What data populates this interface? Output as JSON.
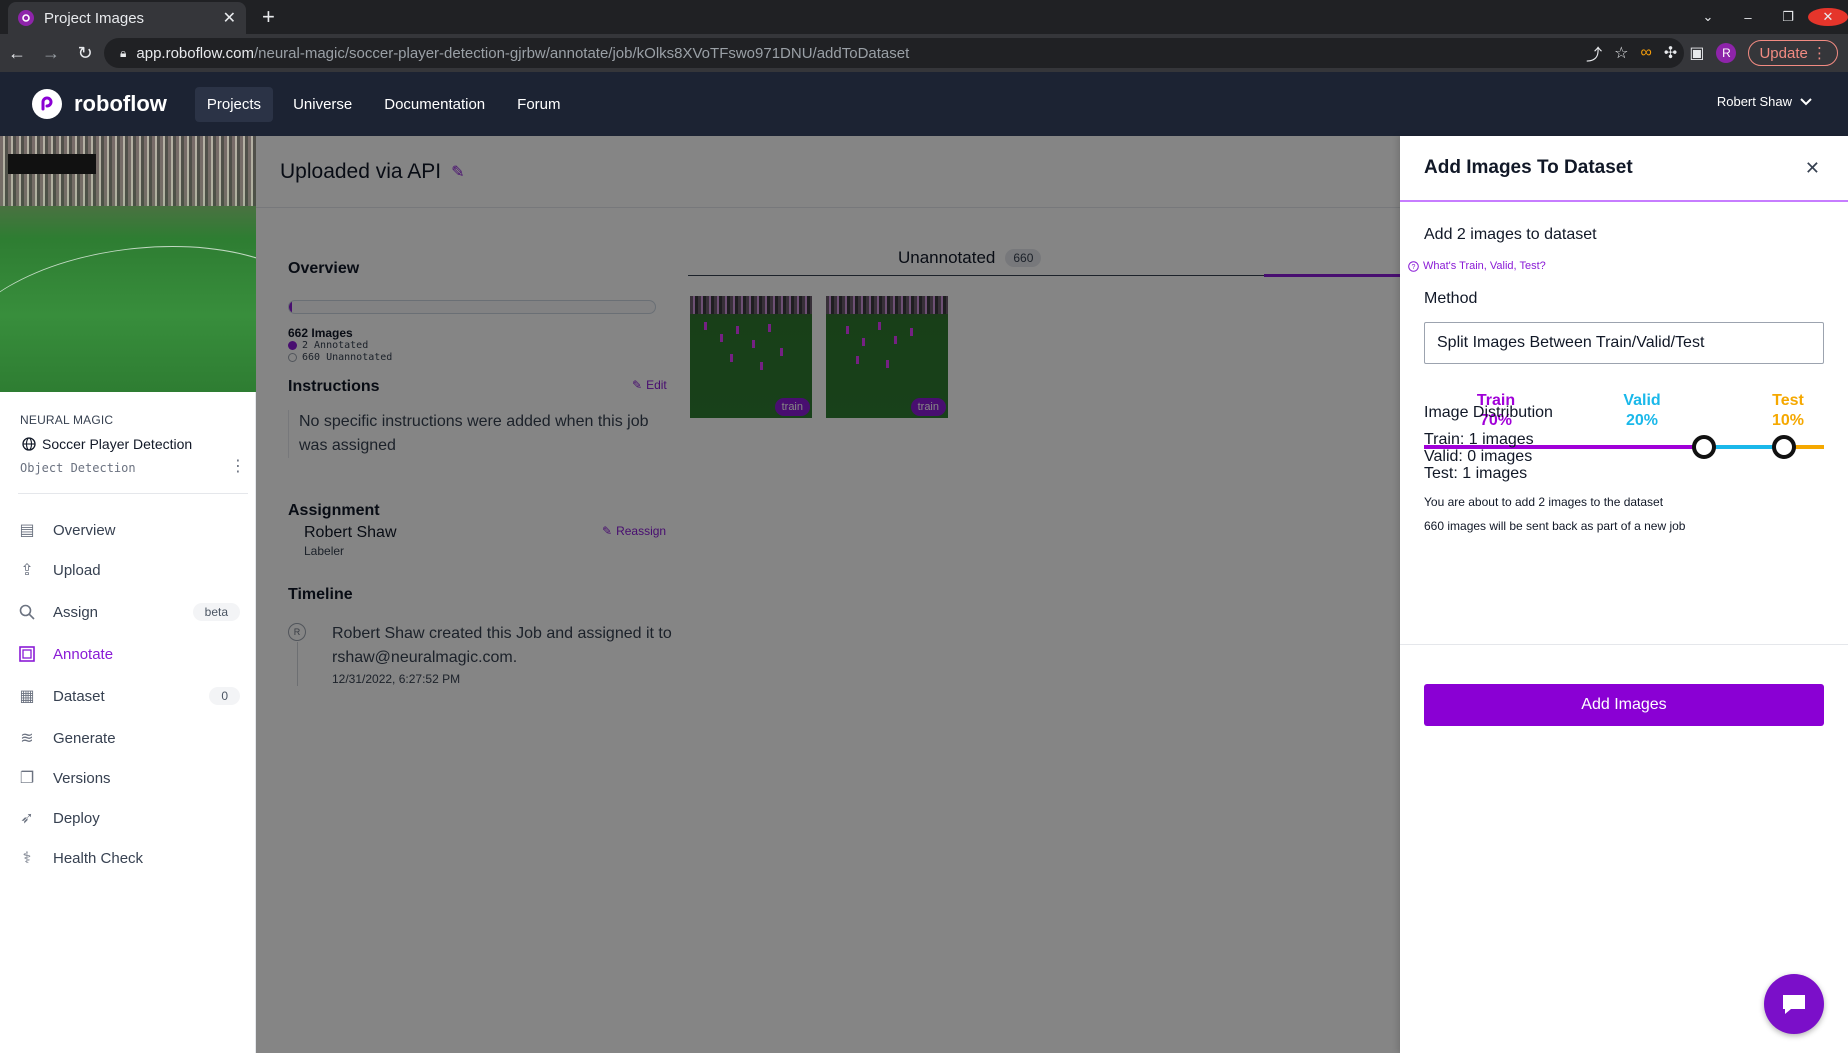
{
  "browser": {
    "tab_title": "Project Images",
    "url_host": "app.roboflow.com",
    "url_path": "/neural-magic/soccer-player-detection-gjrbw/annotate/job/kOlks8XVoTFswo971DNU/addToDataset",
    "profile_initial": "R",
    "update_label": "Update"
  },
  "appbar": {
    "brand": "roboflow",
    "nav": [
      "Projects",
      "Universe",
      "Documentation",
      "Forum"
    ],
    "active_nav": "Projects",
    "user_name": "Robert Shaw"
  },
  "sidebar": {
    "workspace": "NEURAL MAGIC",
    "project_name": "Soccer Player Detection",
    "project_type": "Object Detection",
    "items": [
      {
        "label": "Overview",
        "icon": "overview-icon"
      },
      {
        "label": "Upload",
        "icon": "upload-icon"
      },
      {
        "label": "Assign",
        "icon": "search-icon",
        "badge": "beta"
      },
      {
        "label": "Annotate",
        "icon": "annotate-icon",
        "active": true
      },
      {
        "label": "Dataset",
        "icon": "dataset-icon",
        "badge": "0"
      },
      {
        "label": "Generate",
        "icon": "generate-icon"
      },
      {
        "label": "Versions",
        "icon": "versions-icon"
      },
      {
        "label": "Deploy",
        "icon": "rocket-icon"
      },
      {
        "label": "Health Check",
        "icon": "stethoscope-icon"
      }
    ]
  },
  "main": {
    "title": "Uploaded via API",
    "overview": {
      "title": "Overview",
      "images_label": "662 Images",
      "annotated_label": "2 Annotated",
      "unannotated_label": "660 Unannotated",
      "annotated_fraction": 0.003
    },
    "instructions": {
      "title": "Instructions",
      "edit_label": "Edit",
      "text": "No specific instructions were added when this job was assigned"
    },
    "assignment": {
      "title": "Assignment",
      "reassign_label": "Reassign",
      "assignee": "Robert Shaw",
      "role": "Labeler"
    },
    "timeline": {
      "title": "Timeline",
      "avatar": "R",
      "event": "Robert Shaw created this Job and assigned it to rshaw@neuralmagic.com.",
      "time": "12/31/2022, 6:27:52 PM"
    },
    "tab": {
      "label": "Unannotated",
      "count": "660"
    },
    "images": [
      {
        "split": "train"
      },
      {
        "split": "train"
      }
    ]
  },
  "panel": {
    "title": "Add Images To Dataset",
    "subtitle": "Add 2 images to dataset",
    "help_link": "What's Train, Valid, Test?",
    "method_label": "Method",
    "method_value": "Split Images Between Train/Valid/Test",
    "splits": [
      {
        "name": "Train",
        "pct": "70%",
        "value": 70,
        "color": "#a000d8"
      },
      {
        "name": "Valid",
        "pct": "20%",
        "value": 20,
        "color": "#1ab8ea"
      },
      {
        "name": "Test",
        "pct": "10%",
        "value": 10,
        "color": "#f5a800"
      }
    ],
    "distribution_title": "Image Distribution",
    "dist_train": "Train: 1 images",
    "dist_valid": "Valid: 0 images",
    "dist_test": "Test: 1 images",
    "note_add": "You are about to add 2 images to the dataset",
    "note_sent": "660 images will be sent back as part of a new job",
    "button_label": "Add Images"
  }
}
